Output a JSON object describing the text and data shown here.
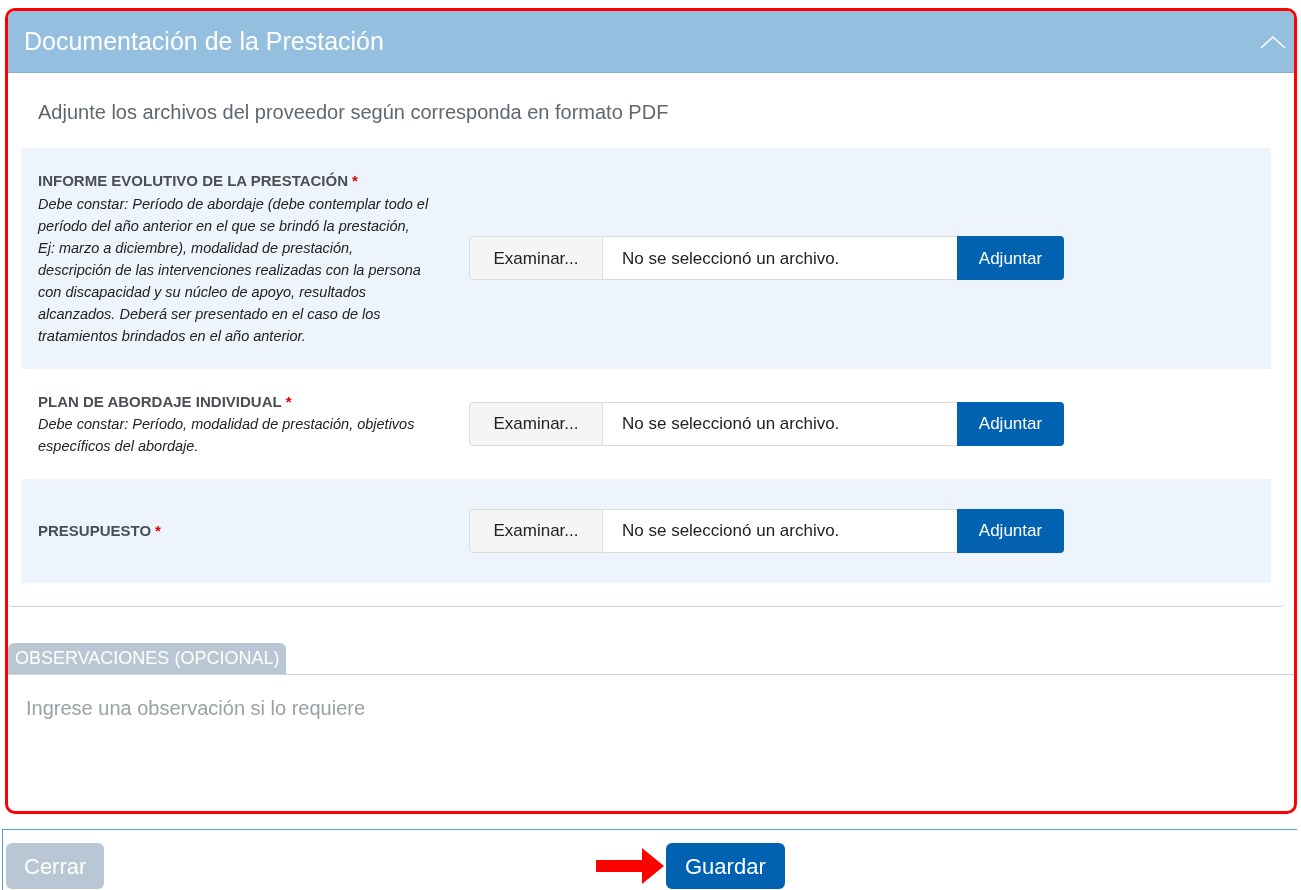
{
  "panel": {
    "title": "Documentación de la Prestación",
    "expanded": true,
    "instruction": "Adjunte los archivos del proveedor según corresponda en formato PDF"
  },
  "documents": [
    {
      "title": "INFORME EVOLUTIVO DE LA PRESTACIÓN",
      "required_mark": "*",
      "description": "Debe constar: Período de abordaje (debe contemplar todo el período del año anterior en el que se brindó la prestación, Ej: marzo a diciembre), modalidad de prestación, descripción de las intervenciones realizadas con la persona con discapacidad y su núcleo de apoyo, resultados alcanzados. Deberá ser presentado en el caso de los tratamientos brindados en el año anterior.",
      "browse_label": "Examinar...",
      "file_status": "No se seleccionó un archivo.",
      "attach_label": "Adjuntar"
    },
    {
      "title": "PLAN DE ABORDAJE INDIVIDUAL",
      "required_mark": "*",
      "description": "Debe constar: Período, modalidad de prestación, objetivos específicos del abordaje.",
      "browse_label": "Examinar...",
      "file_status": "No se seleccionó un archivo.",
      "attach_label": "Adjuntar"
    },
    {
      "title": "PRESUPUESTO",
      "required_mark": "*",
      "browse_label": "Examinar...",
      "file_status": "No se seleccionó un archivo.",
      "attach_label": "Adjuntar"
    }
  ],
  "observations": {
    "label": "OBSERVACIONES (OPCIONAL)",
    "placeholder": "Ingrese una observación si lo requiere"
  },
  "footer": {
    "buttons": [
      {
        "label": "Cerrar",
        "disabled": true,
        "pointer": false
      },
      {
        "label": "Guardar",
        "disabled": false,
        "pointer": true
      }
    ]
  }
}
